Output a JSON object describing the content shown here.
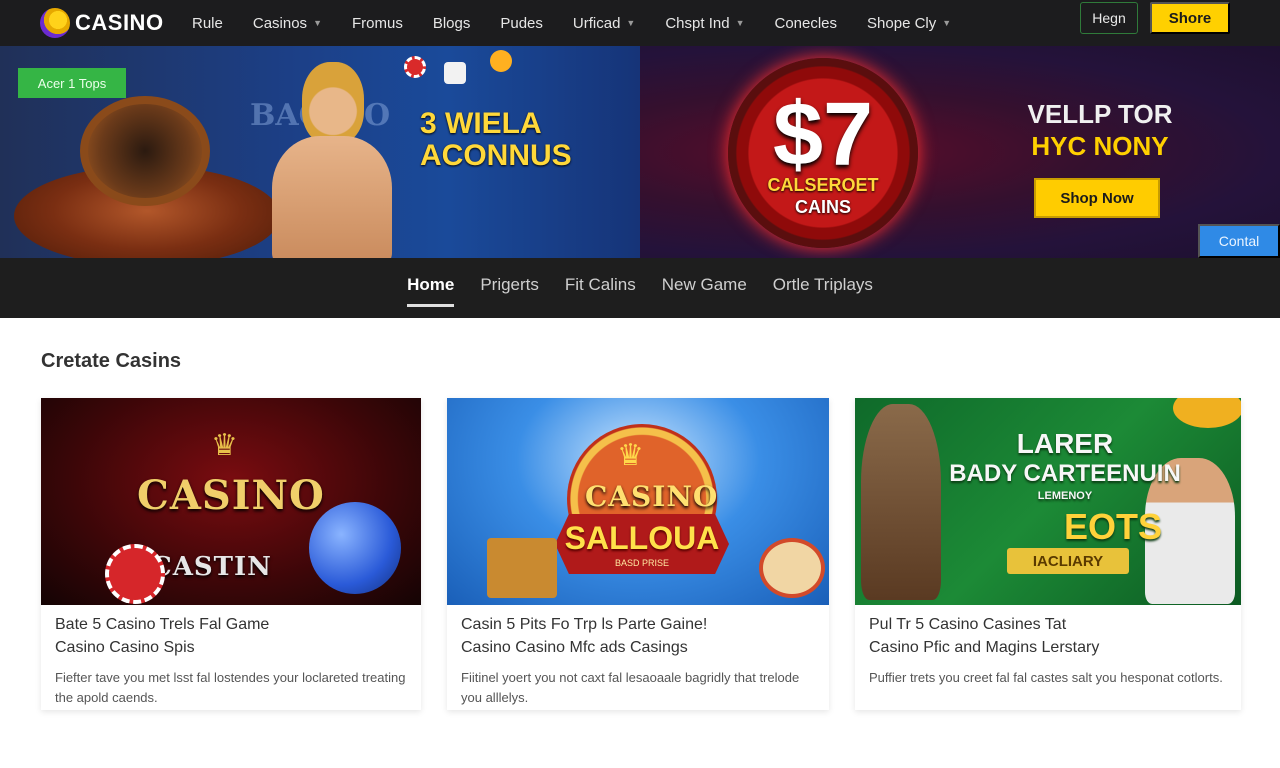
{
  "brand": {
    "logo_text": "CASINO"
  },
  "nav": {
    "items": [
      {
        "label": "Rule",
        "has_caret": false
      },
      {
        "label": "Casinos",
        "has_caret": true
      },
      {
        "label": "Fromus",
        "has_caret": false
      },
      {
        "label": "Blogs",
        "has_caret": false
      },
      {
        "label": "Pudes",
        "has_caret": false
      },
      {
        "label": "Urficad",
        "has_caret": true
      },
      {
        "label": "Chspt Ind",
        "has_caret": true
      },
      {
        "label": "Conecles",
        "has_caret": false
      },
      {
        "label": "Shope Cly",
        "has_caret": true
      }
    ],
    "login_label": "Hegn",
    "share_label": "Shore"
  },
  "hero_left": {
    "badge": "Acer 1 Tops",
    "title_line1": "3 WIELA",
    "title_line2": "ACONNUS",
    "background_word": "BACINO"
  },
  "hero_right": {
    "ring_symbol": "$7",
    "ring_line1": "CALSEROET",
    "ring_line2": "CAINS",
    "title_line1": "VELLP TOR",
    "title_line2": "HYC NONY",
    "cta_label": "Shop Now",
    "contact_label": "Contal"
  },
  "subnav": {
    "items": [
      {
        "label": "Home",
        "active": true
      },
      {
        "label": "Prigerts",
        "active": false
      },
      {
        "label": "Fit Calins",
        "active": false
      },
      {
        "label": "New Game",
        "active": false
      },
      {
        "label": "Ortle Triplays",
        "active": false
      }
    ]
  },
  "section": {
    "title": "Cretate Casins"
  },
  "cards": [
    {
      "image_text": "CASINO",
      "image_subtext": "CASTIN",
      "title": "Bate 5 Casino Trels Fal Game",
      "subtitle": "Casino Casino Spis",
      "description": "Fiefter tave you met lsst fal lostendes your loclareted treating the apold caends."
    },
    {
      "image_text": "CASINO",
      "image_subtext": "SALLOUA",
      "image_small": "BASD PRISE",
      "title": "Casin 5 Pits Fo Trp ls Parte Gaine!",
      "subtitle": "Casino Casino Mfc ads Casings",
      "description": "Fiitinel yoert you not caxt fal lesaoaale bagridly that trelode you alllelys."
    },
    {
      "image_line1": "LARER",
      "image_line2": "BADY CARTEENUIN",
      "image_line3": "LEMENOY",
      "image_line4": "EOTS",
      "image_line5": "IACLIARY",
      "title": "Pul Tr 5 Casino Casines Tat",
      "subtitle": "Casino Pfic and Magins Lerstary",
      "description": "Puffier trets you creet fal fal castes salt you hesponat cotlorts."
    }
  ],
  "colors": {
    "topbar": "#1c1c1e",
    "accent_yellow": "#ffd000",
    "badge_green": "#35b545",
    "contact_blue": "#2f8ae6",
    "subnav": "#1e1e1e"
  }
}
